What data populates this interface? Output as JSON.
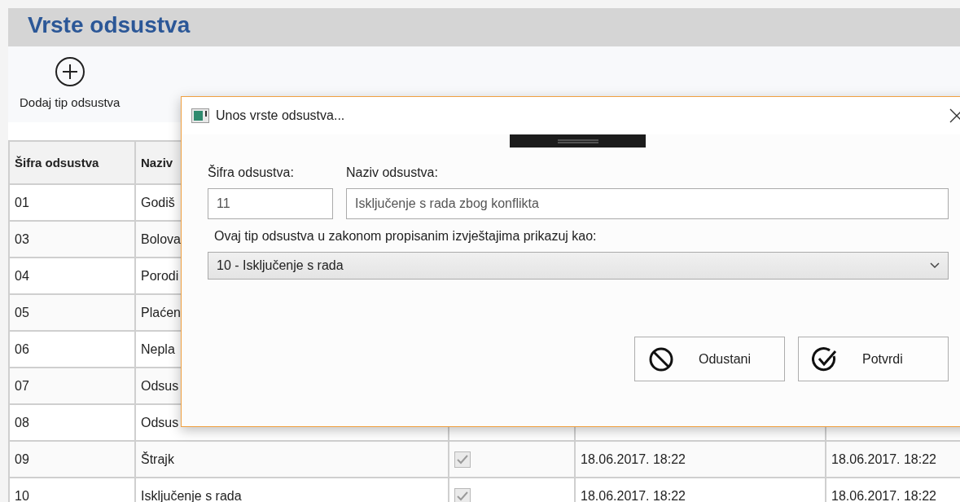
{
  "page": {
    "title": "Vrste odsustva"
  },
  "toolbar": [
    {
      "label": "Dodaj tip odsustva"
    }
  ],
  "table": {
    "columns": [
      "Šifra odsustva",
      "Naziv"
    ],
    "rows": [
      {
        "code": "01",
        "name": "Godiš"
      },
      {
        "code": "03",
        "name": "Bolova"
      },
      {
        "code": "04",
        "name": "Porodi"
      },
      {
        "code": "05",
        "name": "Plaćen"
      },
      {
        "code": "06",
        "name": "Nepla"
      },
      {
        "code": "07",
        "name": "Odsus"
      },
      {
        "code": "08",
        "name": "Odsus"
      },
      {
        "code": "09",
        "name": "Štrajk",
        "checked": true,
        "date_1": "18.06.2017. 18:22",
        "date_2": "18.06.2017. 18:22"
      },
      {
        "code": "10",
        "name": "Isključenje s rada",
        "checked": true,
        "date_1": "18.06.2017. 18:22",
        "date_2": "18.06.2017. 18:22"
      }
    ]
  },
  "dialog": {
    "title": "Unos vrste odsustva...",
    "code_label": "Šifra odsustva:",
    "code_value": "11",
    "name_label": "Naziv odsustva:",
    "name_value": "Isključenje s rada zbog konflikta",
    "report_label": "Ovaj tip odsustva u zakonom propisanim izvještajima prikazuj kao:",
    "report_value": "10 - Isključenje s rada",
    "buttons": [
      {
        "kind": "cancel",
        "label": "Odustani"
      },
      {
        "kind": "confirm",
        "label": "Potvrdi"
      }
    ]
  }
}
